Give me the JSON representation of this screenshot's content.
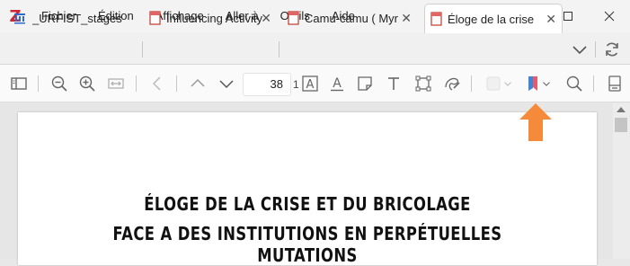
{
  "app": {
    "logo": "Z"
  },
  "menu": [
    "Fichier",
    "Édition",
    "Affichage",
    "Aller à",
    "Outils",
    "Aide"
  ],
  "window_controls": {
    "minimize": "─",
    "maximize": "☐",
    "close": "✕"
  },
  "tabs": [
    {
      "label": "_URFIST_stages",
      "icon": "library-icon"
    },
    {
      "label": "Influencing Activity",
      "icon": "pdf-icon"
    },
    {
      "label": "Camu-camu ( Myr",
      "icon": "pdf-icon"
    },
    {
      "label": "Éloge de la crise",
      "icon": "pdf-icon",
      "active": true
    }
  ],
  "toolbar": {
    "page_number": "38",
    "page_total": "1",
    "icons": [
      "sidebar-toggle-icon",
      "zoom-out-icon",
      "zoom-in-icon",
      "fit-width-icon",
      "back-icon",
      "page-up-icon",
      "page-down-icon",
      "highlight-text-icon",
      "underline-text-icon",
      "note-icon",
      "text-icon",
      "select-area-icon",
      "draw-icon",
      "color-picker-icon",
      "bookmark-icon",
      "search-icon",
      "context-pane-icon"
    ]
  },
  "document": {
    "title_line1": "ÉLOGE DE LA CRISE ET DU BRICOLAGE",
    "title_line2": "FACE A DES INSTITUTIONS EN PERPÉTUELLES MUTATIONS"
  },
  "colors": {
    "accent": "#cc2936",
    "annotation_arrow": "#f58a3a"
  }
}
